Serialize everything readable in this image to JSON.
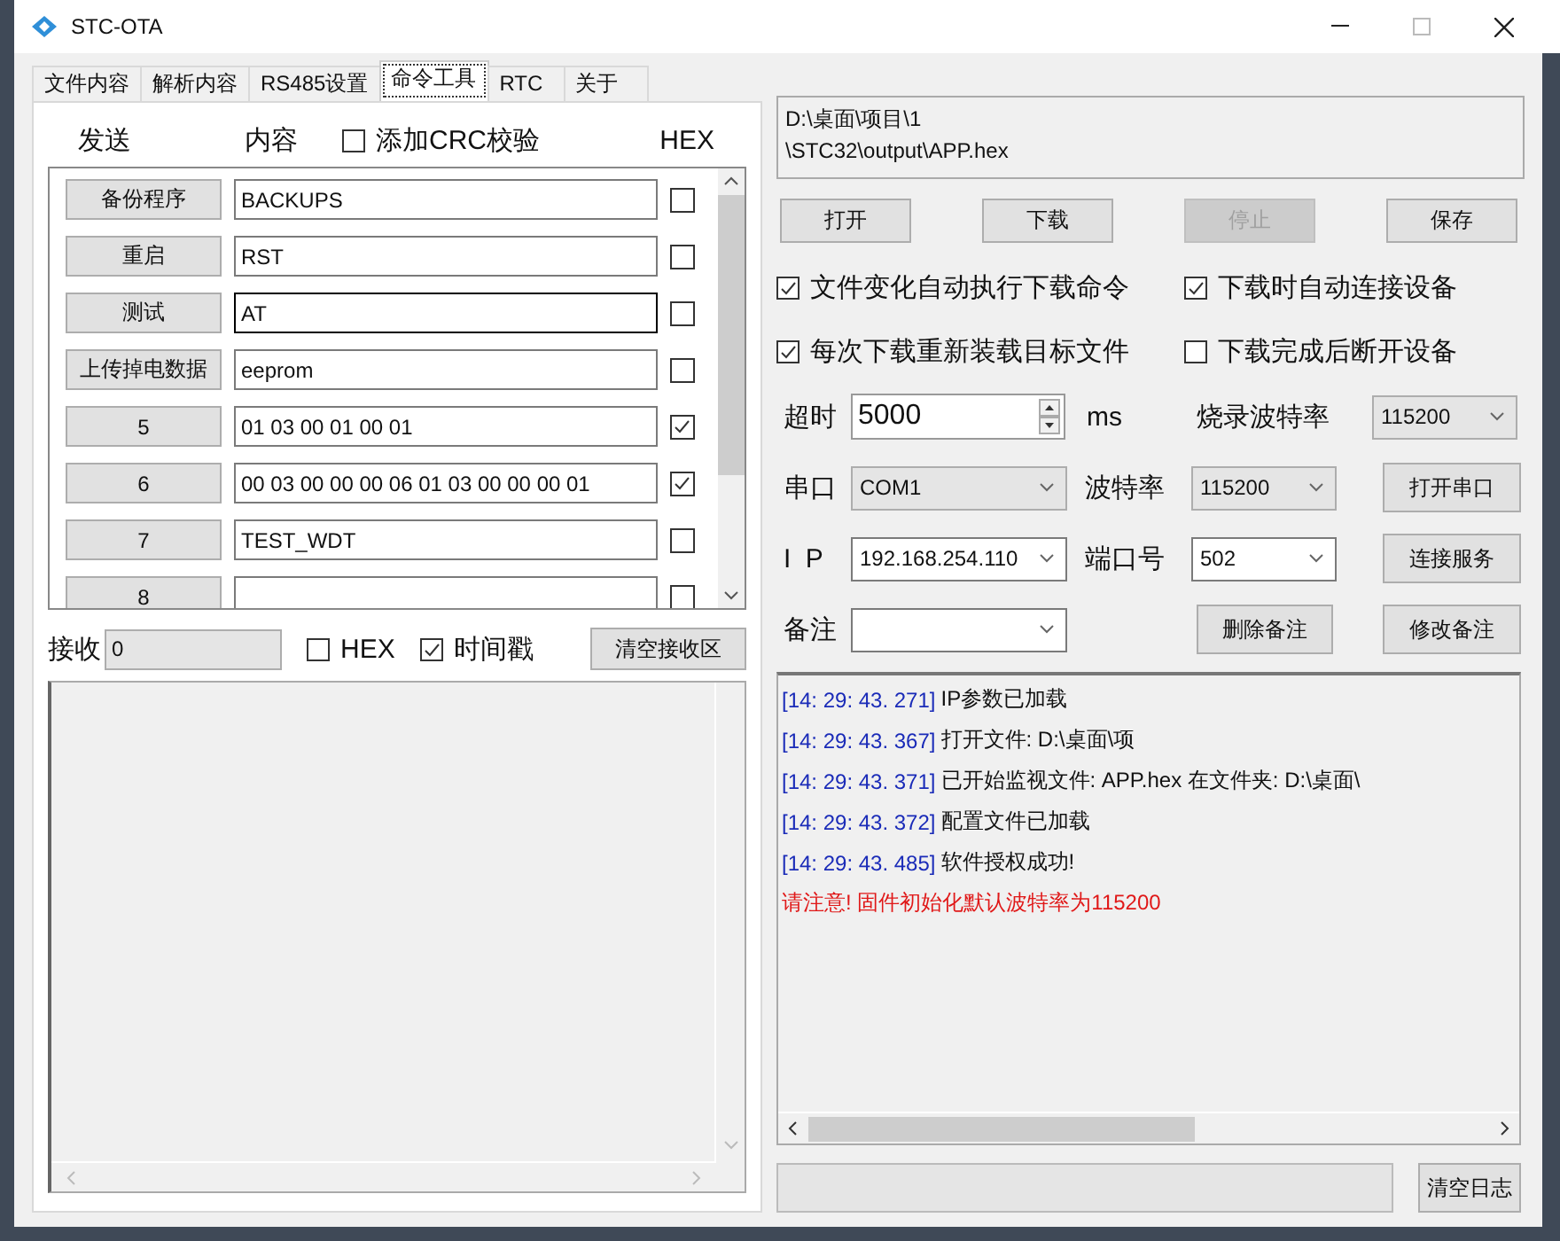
{
  "window": {
    "title": "STC-OTA"
  },
  "tabs": [
    {
      "label": "文件内容",
      "selected": false
    },
    {
      "label": "解析内容",
      "selected": false
    },
    {
      "label": "RS485设置",
      "selected": false
    },
    {
      "label": "命令工具",
      "selected": true
    },
    {
      "label": "RTC",
      "selected": false
    },
    {
      "label": "关于",
      "selected": false
    }
  ],
  "send_panel": {
    "send_label": "发送",
    "content_label": "内容",
    "crc": {
      "label": "添加CRC校验",
      "checked": false
    },
    "hex_label": "HEX"
  },
  "commands": [
    {
      "button": "备份程序",
      "value": "BACKUPS",
      "hex": false
    },
    {
      "button": "重启",
      "value": "RST",
      "hex": false
    },
    {
      "button": "测试",
      "value": "AT",
      "hex": false
    },
    {
      "button": "上传掉电数据",
      "value": "eeprom",
      "hex": false
    },
    {
      "button": "5",
      "value": "01 03 00 01 00 01",
      "hex": true
    },
    {
      "button": "6",
      "value": "00 03 00 00 00 06 01 03 00 00  00 01",
      "hex": true
    },
    {
      "button": "7",
      "value": "TEST_WDT",
      "hex": false
    },
    {
      "button": "8",
      "hex": false
    }
  ],
  "receive": {
    "label": "接收",
    "count": "0",
    "hex": {
      "label": "HEX",
      "checked": false
    },
    "timestamp": {
      "label": "时间戳",
      "checked": true
    },
    "clear_button": "清空接收区"
  },
  "file_path": [
    "D:\\桌面\\项目\\1",
    "\\STC32\\output\\APP.hex"
  ],
  "file_buttons": [
    {
      "label": "打开",
      "disabled": false
    },
    {
      "label": "下载",
      "disabled": false
    },
    {
      "label": "停止",
      "disabled": true
    },
    {
      "label": "保存",
      "disabled": false
    }
  ],
  "options": [
    {
      "label": "文件变化自动执行下载命令",
      "checked": true
    },
    {
      "label": "下载时自动连接设备",
      "checked": true
    },
    {
      "label": "每次下载重新装载目标文件",
      "checked": true
    },
    {
      "label": "下载完成后断开设备",
      "checked": false
    }
  ],
  "timeout": {
    "label": "超时",
    "value": "5000",
    "unit": "ms"
  },
  "burn_baud": {
    "label": "烧录波特率",
    "value": "115200"
  },
  "serial_port": {
    "label": "串口",
    "value": "COM1"
  },
  "baud_rate": {
    "label": "波特率",
    "value": "115200"
  },
  "open_port_button": "打开串口",
  "ip": {
    "label": "I P",
    "value": "192.168.254.110"
  },
  "port_number": {
    "label": "端口号",
    "value": "502"
  },
  "connect_button": "连接服务",
  "note": {
    "label": "备注"
  },
  "delete_note_button": "删除备注",
  "edit_note_button": "修改备注",
  "log": [
    {
      "kind": "entry",
      "time": "[14: 29: 43. 271]",
      "text": "IP参数已加载"
    },
    {
      "kind": "entry",
      "time": "[14: 29: 43. 367]",
      "text": "打开文件:  D:\\桌面\\项"
    },
    {
      "kind": "entry",
      "time": "[14: 29: 43. 371]",
      "text": "已开始监视文件: APP.hex 在文件夹: D:\\桌面\\"
    },
    {
      "kind": "entry",
      "time": "[14: 29: 43. 372]",
      "text": "配置文件已加载"
    },
    {
      "kind": "entry",
      "time": "[14: 29: 43. 485]",
      "text": "软件授权成功!"
    },
    {
      "kind": "warning",
      "text": "请注意!  固件初始化默认波特率为115200"
    }
  ],
  "clear_log_button": "清空日志"
}
